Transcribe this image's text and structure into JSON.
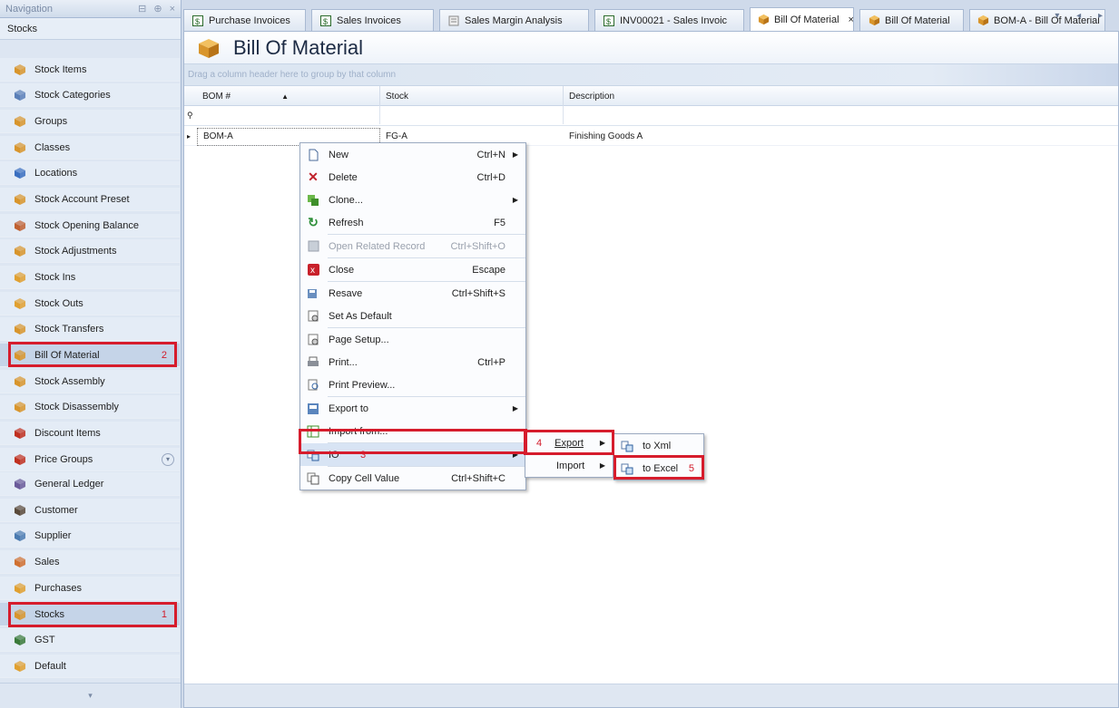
{
  "nav": {
    "header_title": "Navigation",
    "header_controls": [
      "⊟",
      "⊕",
      "×"
    ],
    "group_label": "Stocks",
    "items": [
      {
        "label": "Stock Items",
        "icon": "box-icon",
        "color": "#d8952c"
      },
      {
        "label": "Stock Categories",
        "icon": "categories-icon",
        "color": "#5a7fb8"
      },
      {
        "label": "Groups",
        "icon": "groups-icon",
        "color": "#d8952c"
      },
      {
        "label": "Classes",
        "icon": "classes-icon",
        "color": "#d8952c"
      },
      {
        "label": "Locations",
        "icon": "globe-icon",
        "color": "#3a6fc0"
      },
      {
        "label": "Stock Account Preset",
        "icon": "preset-icon",
        "color": "#d8952c"
      },
      {
        "label": "Stock Opening Balance",
        "icon": "opening-icon",
        "color": "#c06030"
      },
      {
        "label": "Stock Adjustments",
        "icon": "box-icon",
        "color": "#d8952c"
      },
      {
        "label": "Stock Ins",
        "icon": "stock-in-icon",
        "color": "#e0a030"
      },
      {
        "label": "Stock Outs",
        "icon": "stock-out-icon",
        "color": "#e0a030"
      },
      {
        "label": "Stock Transfers",
        "icon": "box-icon",
        "color": "#d8952c"
      },
      {
        "label": "Bill Of Material",
        "icon": "box-icon",
        "color": "#d8952c",
        "step": "2"
      },
      {
        "label": "Stock Assembly",
        "icon": "box-icon",
        "color": "#d8952c"
      },
      {
        "label": "Stock Disassembly",
        "icon": "box-icon",
        "color": "#d8952c"
      },
      {
        "label": "Discount Items",
        "icon": "discount-icon",
        "color": "#c03020"
      },
      {
        "label": "Price Groups",
        "icon": "price-icon",
        "color": "#c03020"
      }
    ],
    "modules": [
      {
        "label": "General Ledger",
        "icon": "ledger-icon",
        "color": "#6a5a9a"
      },
      {
        "label": "Customer",
        "icon": "customer-icon",
        "color": "#5a4a3a"
      },
      {
        "label": "Supplier",
        "icon": "supplier-icon",
        "color": "#4a7ab0"
      },
      {
        "label": "Sales",
        "icon": "sales-icon",
        "color": "#d07030"
      },
      {
        "label": "Purchases",
        "icon": "purchases-icon",
        "color": "#e0a030"
      },
      {
        "label": "Stocks",
        "icon": "box-icon",
        "color": "#d8952c",
        "step": "1"
      },
      {
        "label": "GST",
        "icon": "gst-icon",
        "color": "#3a7a3a"
      },
      {
        "label": "Default",
        "icon": "folder-icon",
        "color": "#e0a030"
      }
    ]
  },
  "tabs": [
    {
      "label": "Purchase Invoices",
      "icon": "dollar-icon"
    },
    {
      "label": "Sales Invoices",
      "icon": "dollar-icon"
    },
    {
      "label": "Sales Margin Analysis",
      "icon": "report-icon"
    },
    {
      "label": "INV00021 - Sales Invoic",
      "icon": "dollar-icon"
    },
    {
      "label": "Bill Of Material",
      "icon": "box-icon",
      "active": true,
      "close": "×"
    },
    {
      "label": "Bill Of Material",
      "icon": "box-icon"
    },
    {
      "label": "BOM-A - Bill Of Material",
      "icon": "box-icon"
    }
  ],
  "tab_controls": "▾ ◂ ▸",
  "doc": {
    "title": "Bill Of Material",
    "group_hint": "Drag a column header here to group by that column",
    "columns": [
      "BOM #",
      "Stock",
      "Description"
    ],
    "sort_indicator": "▲",
    "filter_icon": "⚲",
    "rows": [
      {
        "bom": "BOM-A",
        "stock": "FG-A",
        "description": "Finishing Goods A"
      }
    ]
  },
  "context_menu": {
    "items": [
      {
        "label": "New",
        "shortcut": "Ctrl+N",
        "icon": "new-icon",
        "submenu": true
      },
      {
        "label": "Delete",
        "shortcut": "Ctrl+D",
        "icon": "delete-icon"
      },
      {
        "label": "Clone...",
        "shortcut": "",
        "icon": "clone-icon",
        "submenu": true
      },
      {
        "label": "Refresh",
        "shortcut": "F5",
        "icon": "refresh-icon"
      },
      {
        "label": "Open Related Record",
        "shortcut": "Ctrl+Shift+O",
        "icon": "open-related-icon",
        "disabled": true
      },
      {
        "label": "Close",
        "shortcut": "Escape",
        "icon": "close-icon"
      },
      {
        "label": "Resave",
        "shortcut": "Ctrl+Shift+S",
        "icon": "resave-icon"
      },
      {
        "label": "Set As Default",
        "shortcut": "",
        "icon": "set-default-icon"
      },
      {
        "label": "Page Setup...",
        "shortcut": "",
        "icon": "page-setup-icon"
      },
      {
        "label": "Print...",
        "shortcut": "Ctrl+P",
        "icon": "print-icon"
      },
      {
        "label": "Print Preview...",
        "shortcut": "",
        "icon": "print-preview-icon"
      },
      {
        "label": "Export to",
        "shortcut": "",
        "icon": "export-icon",
        "submenu": true
      },
      {
        "label": "Import from...",
        "shortcut": "",
        "icon": "import-icon"
      },
      {
        "label": "IO",
        "shortcut": "",
        "icon": "io-icon",
        "submenu": true,
        "step": "3"
      },
      {
        "label": "Copy Cell Value",
        "shortcut": "Ctrl+Shift+C",
        "icon": "copy-icon"
      }
    ],
    "io_submenu": [
      {
        "label": "Export",
        "step": "4"
      },
      {
        "label": "Import"
      }
    ],
    "export_submenu": [
      {
        "label": "to Xml"
      },
      {
        "label": "to Excel",
        "step": "5"
      }
    ]
  },
  "colors": {
    "highlight_red": "#d61c2c",
    "step_red": "#d21b2a",
    "title_text": "#1d2b44"
  }
}
